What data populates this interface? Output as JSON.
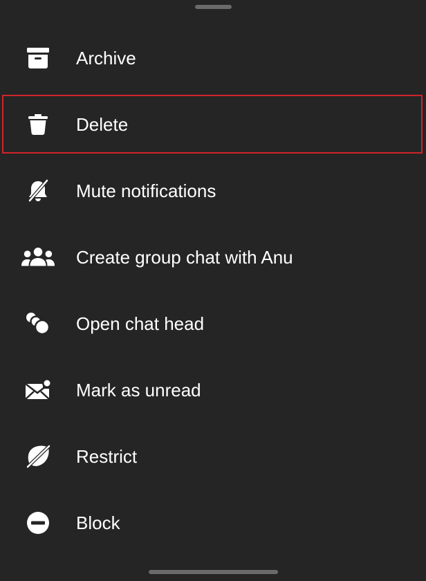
{
  "menu": {
    "items": [
      {
        "label": "Archive",
        "icon": "archive-icon"
      },
      {
        "label": "Delete",
        "icon": "trash-icon"
      },
      {
        "label": "Mute notifications",
        "icon": "bell-off-icon"
      },
      {
        "label": "Create group chat with Anu",
        "icon": "group-icon"
      },
      {
        "label": "Open chat head",
        "icon": "chat-head-icon"
      },
      {
        "label": "Mark as unread",
        "icon": "envelope-unread-icon"
      },
      {
        "label": "Restrict",
        "icon": "restrict-icon"
      },
      {
        "label": "Block",
        "icon": "block-icon"
      }
    ],
    "highlighted_item": "Delete"
  },
  "colors": {
    "background": "#252525",
    "text": "#ffffff",
    "highlight_border": "#d0242b",
    "handle": "#6a6a6a"
  }
}
